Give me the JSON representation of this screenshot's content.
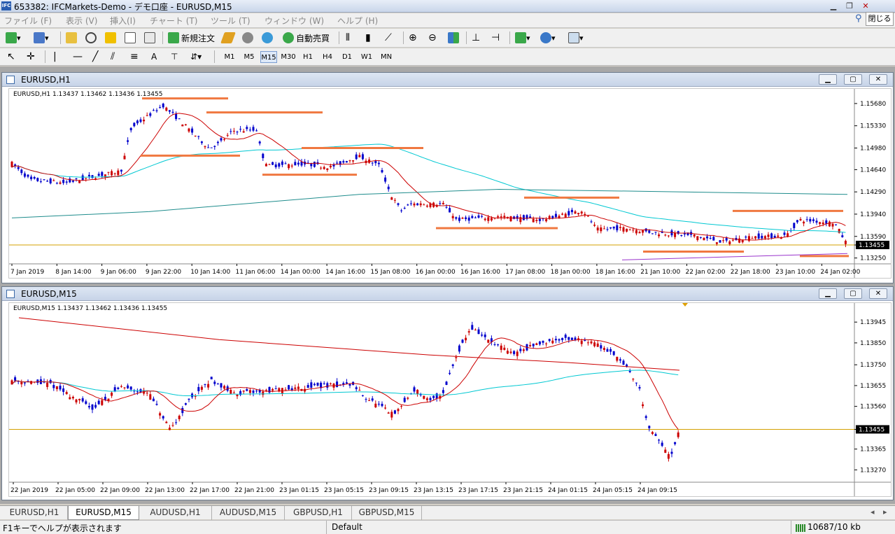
{
  "titlebar": {
    "title": "653382: IFCMarkets-Demo - デモ口座 - EURUSD,M15",
    "icon_text": "IFC",
    "close_label": "閉じる"
  },
  "menu": [
    "ファイル (F)",
    "表示 (V)",
    "挿入(I)",
    "チャート (T)",
    "ツール (T)",
    "ウィンドウ (W)",
    "ヘルプ (H)"
  ],
  "toolbar": {
    "new_order": "新規注文",
    "auto_trading": "自動売買"
  },
  "timeframes": [
    "M1",
    "M5",
    "M15",
    "M30",
    "H1",
    "H4",
    "D1",
    "W1",
    "MN"
  ],
  "active_timeframe": "M15",
  "drawing_tools": {
    "text_tool": "A"
  },
  "chart_h1": {
    "window_title": "EURUSD,H1",
    "header": "EURUSD,H1  1.13437 1.13462 1.13436 1.13455",
    "price_labels": [
      "1.15680",
      "1.15330",
      "1.14980",
      "1.14640",
      "1.14290",
      "1.13940",
      "1.13590",
      "1.13455",
      "1.13250"
    ],
    "current_price": "1.13455",
    "time_labels": [
      "7 Jan 2019",
      "8 Jan 14:00",
      "9 Jan 06:00",
      "9 Jan 22:00",
      "10 Jan 14:00",
      "11 Jan 06:00",
      "14 Jan 00:00",
      "14 Jan 16:00",
      "15 Jan 08:00",
      "16 Jan 00:00",
      "16 Jan 16:00",
      "17 Jan 08:00",
      "18 Jan 00:00",
      "18 Jan 16:00",
      "21 Jan 10:00",
      "22 Jan 02:00",
      "22 Jan 18:00",
      "23 Jan 10:00",
      "24 Jan 02:00"
    ]
  },
  "chart_m15": {
    "window_title": "EURUSD,M15",
    "header": "EURUSD,M15  1.13437 1.13462 1.13436 1.13455",
    "price_labels": [
      "1.13945",
      "1.13850",
      "1.13750",
      "1.13655",
      "1.13560",
      "1.13455",
      "1.13365",
      "1.13270"
    ],
    "current_price": "1.13455",
    "time_labels": [
      "22 Jan 2019",
      "22 Jan 05:00",
      "22 Jan 09:00",
      "22 Jan 13:00",
      "22 Jan 17:00",
      "22 Jan 21:00",
      "23 Jan 01:15",
      "23 Jan 05:15",
      "23 Jan 09:15",
      "23 Jan 13:15",
      "23 Jan 17:15",
      "23 Jan 21:15",
      "24 Jan 01:15",
      "24 Jan 05:15",
      "24 Jan 09:15"
    ]
  },
  "tabs": [
    "EURUSD,H1",
    "EURUSD,M15",
    "AUDUSD,H1",
    "AUDUSD,M15",
    "GBPUSD,H1",
    "GBPUSD,M15"
  ],
  "active_tab": "EURUSD,M15",
  "status": {
    "help": "F1キーでヘルプが表示されます",
    "profile": "Default",
    "traffic": "10687/10 kb"
  },
  "colors": {
    "bull": "#0000cc",
    "bear": "#cc0000",
    "ma_fast": "#cc0000",
    "ma_mid": "#00c8d2",
    "ma_slow": "#1e8c8c",
    "level_lines": "#f07840",
    "price_line": "#d4a000"
  }
}
